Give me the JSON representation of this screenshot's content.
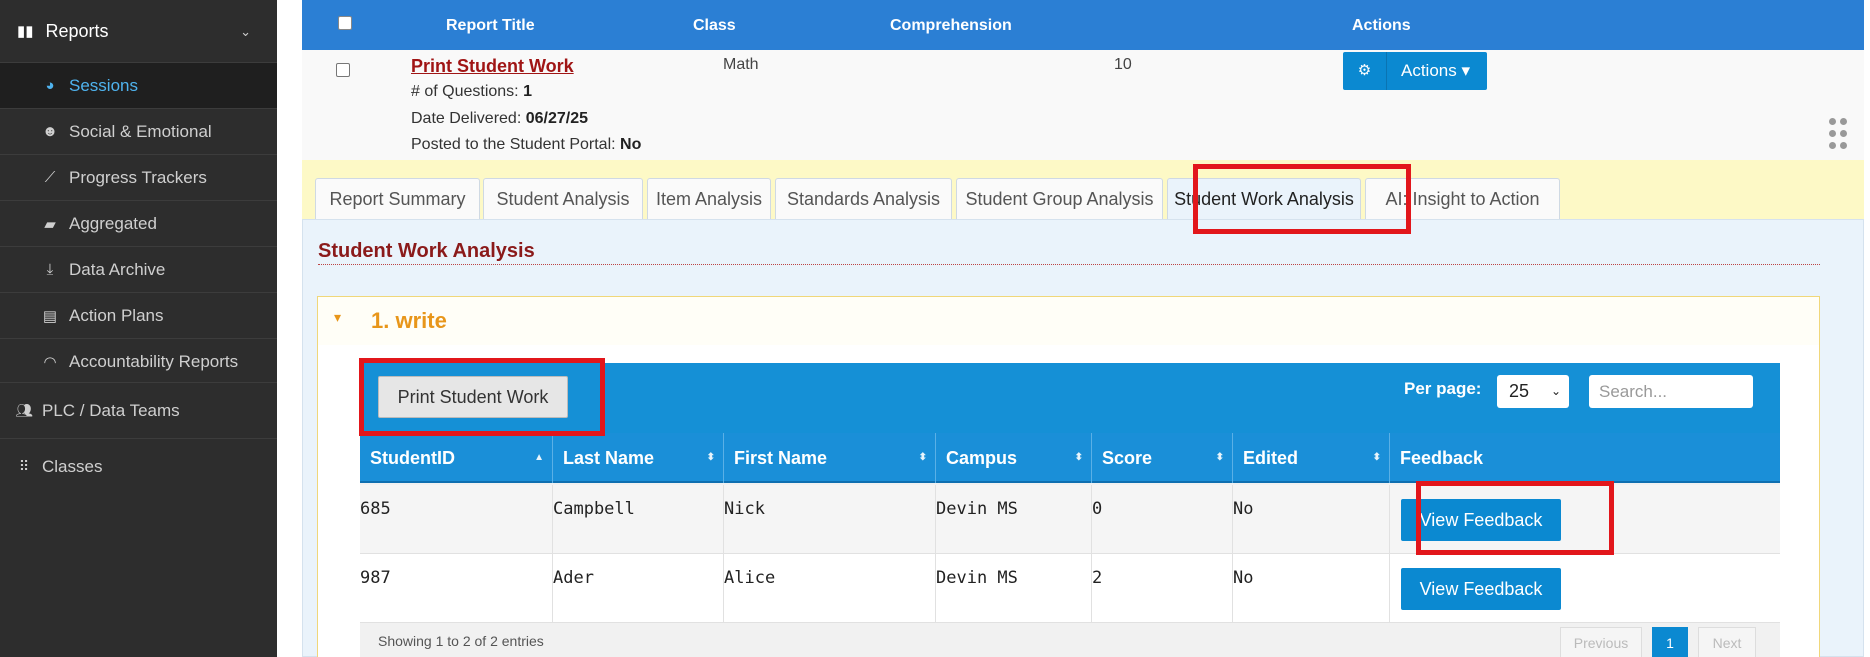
{
  "sidebar": {
    "reports_label": "Reports",
    "items": [
      {
        "label": "Sessions",
        "icon": "pie-chart-icon",
        "glyph": "◕"
      },
      {
        "label": "Social & Emotional",
        "icon": "smiley-icon",
        "glyph": "☻"
      },
      {
        "label": "Progress Trackers",
        "icon": "line-chart-icon",
        "glyph": "⟋"
      },
      {
        "label": "Aggregated",
        "icon": "briefcase-icon",
        "glyph": "▰"
      },
      {
        "label": "Data Archive",
        "icon": "download-icon",
        "glyph": "⤓"
      },
      {
        "label": "Action Plans",
        "icon": "clipboard-icon",
        "glyph": "▤"
      },
      {
        "label": "Accountability Reports",
        "icon": "gauge-icon",
        "glyph": "◠"
      }
    ],
    "plc_label": "PLC / Data Teams",
    "classes_label": "Classes"
  },
  "report_table": {
    "headers": {
      "title": "Report Title",
      "class": "Class",
      "comprehension": "Comprehension",
      "actions": "Actions"
    },
    "row": {
      "title": "Print Student Work",
      "questions_label": "# of Questions: ",
      "questions_value": "1",
      "delivered_label": "Date Delivered: ",
      "delivered_value": "06/27/25",
      "posted_label": "Posted to the Student Portal: ",
      "posted_value": "No",
      "class": "Math",
      "comprehension": "10",
      "actions_label": "Actions ▾"
    }
  },
  "tabs": [
    {
      "label": "Report Summary"
    },
    {
      "label": "Student Analysis"
    },
    {
      "label": "Item Analysis"
    },
    {
      "label": "Standards Analysis"
    },
    {
      "label": "Student Group Analysis"
    },
    {
      "label": "Student Work Analysis",
      "active": true
    },
    {
      "label": "AI: Insight to Action"
    }
  ],
  "panel": {
    "title": "Student Work Analysis",
    "accordion_title": "1. write",
    "print_button": "Print Student Work",
    "per_page_label": "Per page:",
    "per_page_value": "25",
    "search_placeholder": "Search...",
    "columns": [
      "StudentID",
      "Last Name",
      "First Name",
      "Campus",
      "Score",
      "Edited",
      "Feedback"
    ],
    "rows": [
      {
        "id": "685",
        "last": "Campbell",
        "first": "Nick",
        "campus": "Devin MS",
        "score": "0",
        "edited": "No",
        "feedback": "View Feedback"
      },
      {
        "id": "987",
        "last": "Ader",
        "first": "Alice",
        "campus": "Devin MS",
        "score": "2",
        "edited": "No",
        "feedback": "View Feedback"
      }
    ],
    "info": "Showing 1 to 2 of 2 entries",
    "pagination": {
      "previous": "Previous",
      "current": "1",
      "next": "Next"
    }
  },
  "colors": {
    "header_blue": "#2b7fd4",
    "table_blue": "#1590d6",
    "button_blue": "#0b89d1",
    "highlight_red": "#e2161b",
    "title_red": "#a01515",
    "accordion_orange": "#e8961a"
  }
}
